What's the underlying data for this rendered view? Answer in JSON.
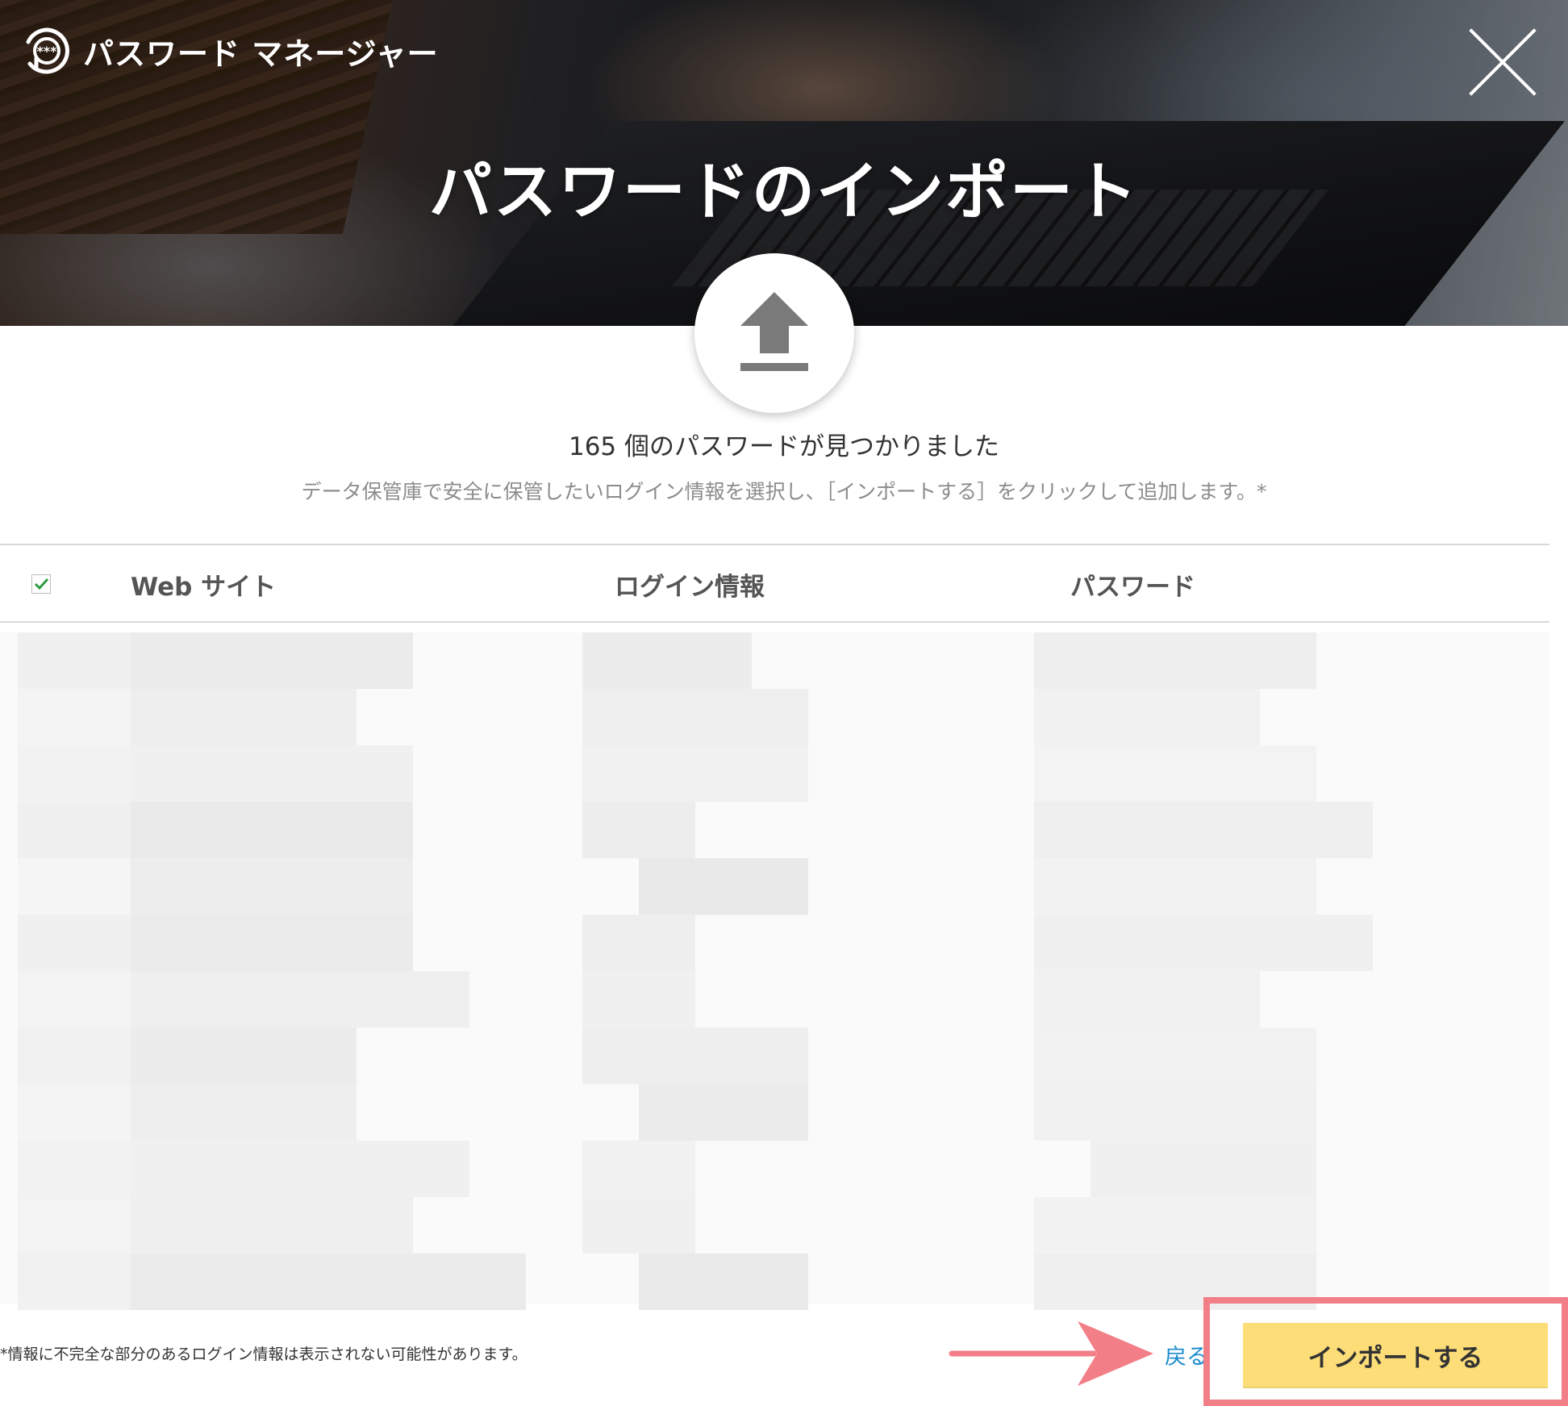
{
  "header": {
    "app_name": "パスワード マネージャー",
    "title": "パスワードのインポート"
  },
  "summary": {
    "found_text": "165 個のパスワードが見つかりました",
    "description": "データ保管庫で安全に保管したいログイン情報を選択し、［インポートする］をクリックして追加します。*"
  },
  "table": {
    "select_all_checked": true,
    "columns": [
      "Web サイト",
      "ログイン情報",
      "パスワード"
    ]
  },
  "footer": {
    "footnote": "*情報に不完全な部分のあるログイン情報は表示されない可能性があります。",
    "back_label": "戻る",
    "import_label": "インポートする"
  },
  "colors": {
    "import_button": "#fcdd78",
    "highlight_border": "#f27f87",
    "annotation_arrow": "#f27f87",
    "back_link": "#1a8ccd",
    "checkbox_check": "#2e9e3f"
  }
}
